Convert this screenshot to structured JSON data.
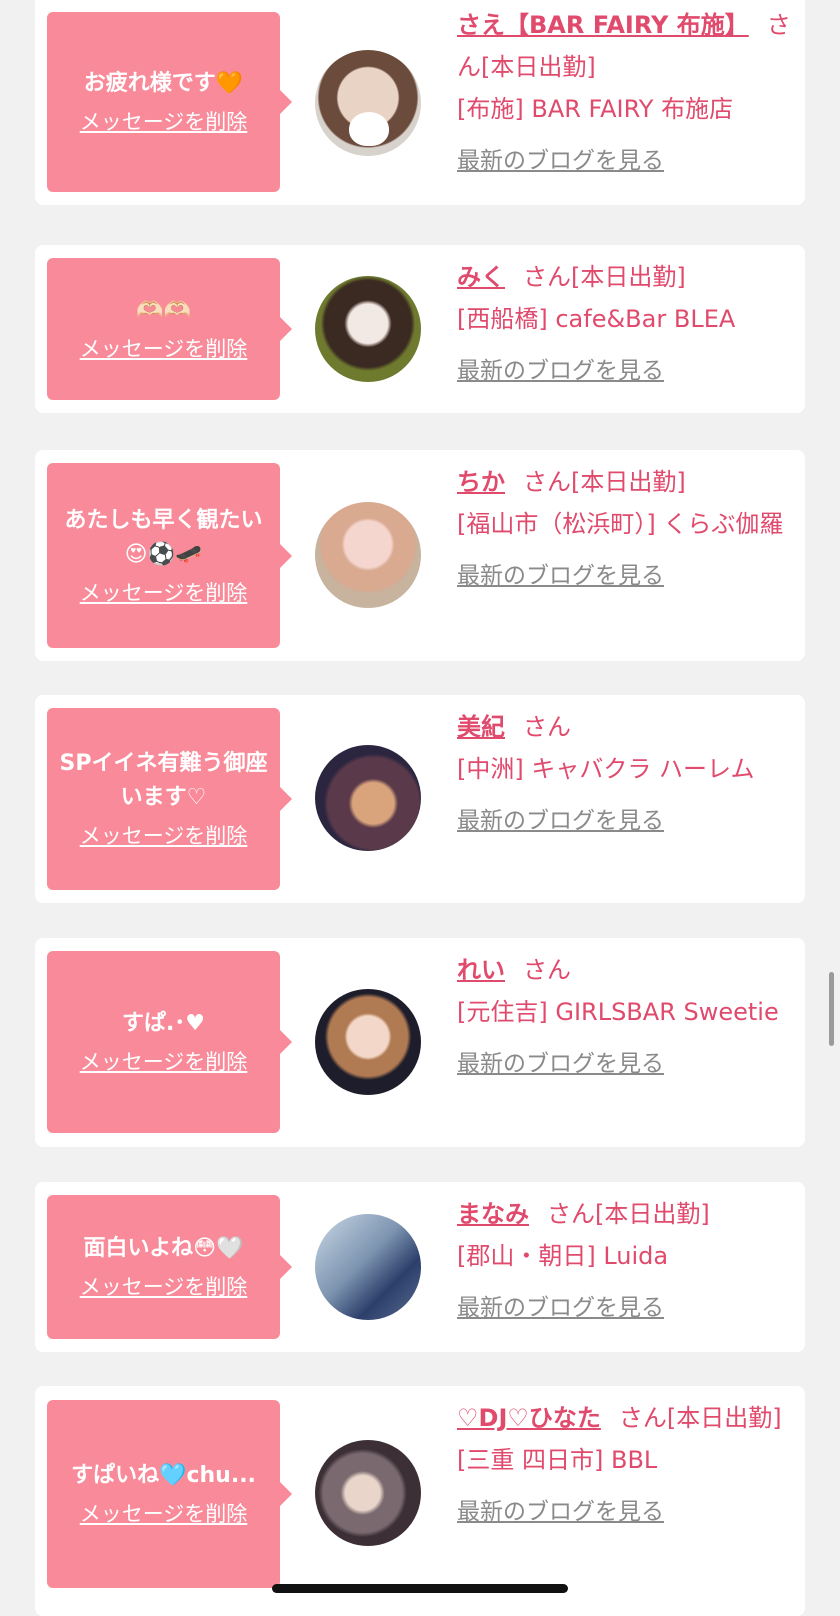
{
  "items": [
    {
      "message": "お疲れ様です🧡",
      "delete_label": "メッセージを削除",
      "name": "さえ【BAR FAIRY 布施】",
      "suffix": "さん[本日出勤]",
      "shop": "[布施] BAR FAIRY 布施店",
      "blog_label": "最新のブログを見る"
    },
    {
      "message": "🫶🏻🫶🏻",
      "delete_label": "メッセージを削除",
      "name": "みく",
      "suffix": "さん[本日出勤]",
      "shop": "[西船橋] cafe&Bar BLEA",
      "blog_label": "最新のブログを見る"
    },
    {
      "message": "あたしも早く観たい😍⚽️🛹",
      "delete_label": "メッセージを削除",
      "name": "ちか",
      "suffix": "さん[本日出勤]",
      "shop": "[福山市（松浜町）] くらぶ伽羅",
      "blog_label": "最新のブログを見る"
    },
    {
      "message": "SPイイネ有難う御座います♡",
      "delete_label": "メッセージを削除",
      "name": "美紀",
      "suffix": "さん",
      "shop": "[中洲] キャバクラ ハーレム",
      "blog_label": "最新のブログを見る"
    },
    {
      "message": "すぱ.･♥",
      "delete_label": "メッセージを削除",
      "name": "れい",
      "suffix": "さん",
      "shop": "[元住吉] GIRLSBAR Sweetie",
      "blog_label": "最新のブログを見る"
    },
    {
      "message": "面白いよね😳🤍",
      "delete_label": "メッセージを削除",
      "name": "まなみ",
      "suffix": "さん[本日出勤]",
      "shop": "[郡山・朝日] Luida",
      "blog_label": "最新のブログを見る"
    },
    {
      "message": "すぱいね🩵chu...",
      "delete_label": "メッセージを削除",
      "name": "♡DJ♡ひなた",
      "suffix": "さん[本日出勤]",
      "shop": "[三重 四日市] BBL",
      "blog_label": "最新のブログを見る"
    }
  ],
  "colors": {
    "background": "#f1f1f1",
    "card": "#ffffff",
    "bubble": "#f88a99",
    "accent_text": "#e04a6c",
    "link_grey": "#8a8a8a"
  }
}
